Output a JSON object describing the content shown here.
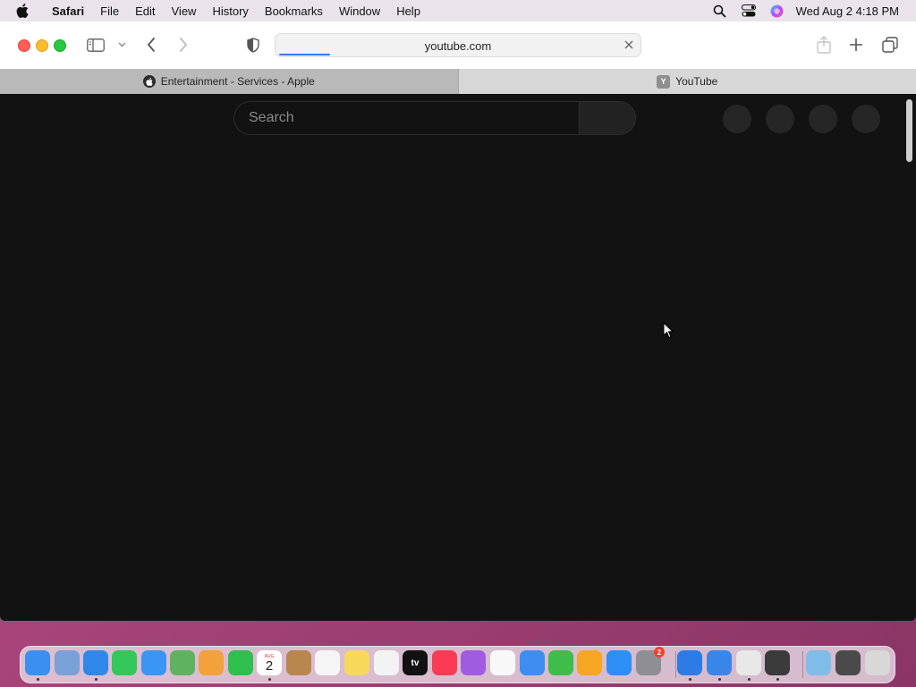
{
  "menubar": {
    "app_name": "Safari",
    "items": [
      "File",
      "Edit",
      "View",
      "History",
      "Bookmarks",
      "Window",
      "Help"
    ],
    "clock": "Wed Aug 2  4:18 PM"
  },
  "toolbar": {
    "url": "youtube.com",
    "load_progress": 0.14
  },
  "tabs": [
    {
      "title": "Entertainment - Services - Apple",
      "favicon": "apple-logo",
      "active": false
    },
    {
      "title": "YouTube",
      "favicon": "Y",
      "active": true
    }
  ],
  "youtube": {
    "search_placeholder": "Search"
  },
  "dock": {
    "calendar_month": "AUG",
    "calendar_day": "2",
    "settings_badge": "2",
    "apps": [
      "finder",
      "launchpad",
      "safari",
      "messages",
      "mail",
      "maps",
      "photos",
      "facetime",
      "calendar",
      "contacts",
      "reminders",
      "notes",
      "freeform",
      "tv",
      "music",
      "podcasts",
      "news",
      "keynote",
      "numbers",
      "pages",
      "app-store",
      "system-settings",
      "xcode",
      "simulator",
      "chrome",
      "instruments",
      "downloads-folder",
      "recent-apps",
      "trash"
    ]
  },
  "colors": {
    "accent": "#3478f6",
    "page_background": "#121212"
  }
}
